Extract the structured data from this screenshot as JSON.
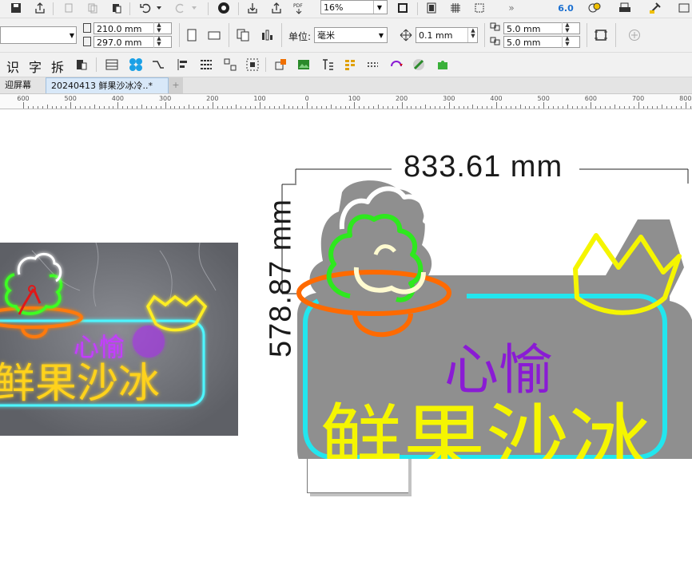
{
  "toolbar_top": {
    "zoom_value": "16%",
    "app_badge": "6.0"
  },
  "property_bar": {
    "width_value": "210.0 mm",
    "height_value": "297.0 mm",
    "units_label": "单位:",
    "units_value": "毫米",
    "nudge_value": "0.1 mm",
    "dup_x_value": "5.0 mm",
    "dup_y_value": "5.0 mm"
  },
  "text_toolbar": {
    "char1": "识",
    "char2": "字",
    "char3": "拆"
  },
  "tabs": {
    "welcome_label": "迎屏幕",
    "doc_label": "20240413 鲜果沙冰冷..*",
    "add_label": "+"
  },
  "ruler": {
    "labels": [
      "600",
      "500",
      "400",
      "300",
      "200",
      "100",
      "0",
      "100",
      "200",
      "300",
      "400",
      "500",
      "600",
      "700",
      "800"
    ]
  },
  "design": {
    "width_dim": "833.61 mm",
    "height_dim": "578.87 mm",
    "subtitle": "心愉",
    "title": "鲜果沙冰"
  },
  "photo": {
    "subtitle": "心愉",
    "title": "鲜果沙冰"
  },
  "colors": {
    "neon_green": "#2ee81e",
    "neon_orange": "#ff6a00",
    "neon_yellow": "#f5f500",
    "neon_purple": "#8a1bd4",
    "neon_cyan": "#22e6ee",
    "board_gray": "#8f8f8f"
  }
}
